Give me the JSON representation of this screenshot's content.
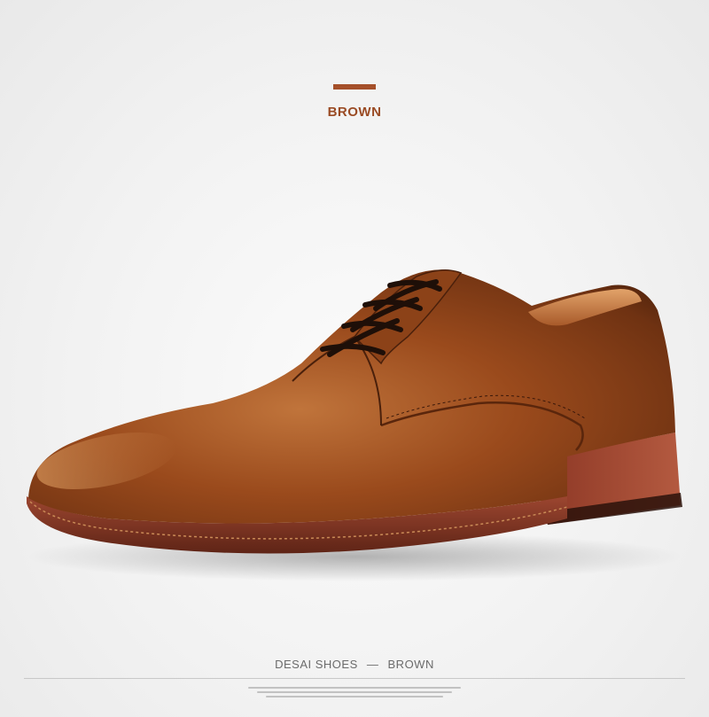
{
  "banner": {
    "color_label": "BROWN",
    "accent_color": "#a5502a"
  },
  "product": {
    "image_name": "brown leather derby dress shoe",
    "leather_color": "#8a3f17",
    "sole_color": "#8c3a24"
  },
  "footer": {
    "brand": "DESAI SHOES",
    "separator": "—",
    "color_name": "BROWN"
  }
}
